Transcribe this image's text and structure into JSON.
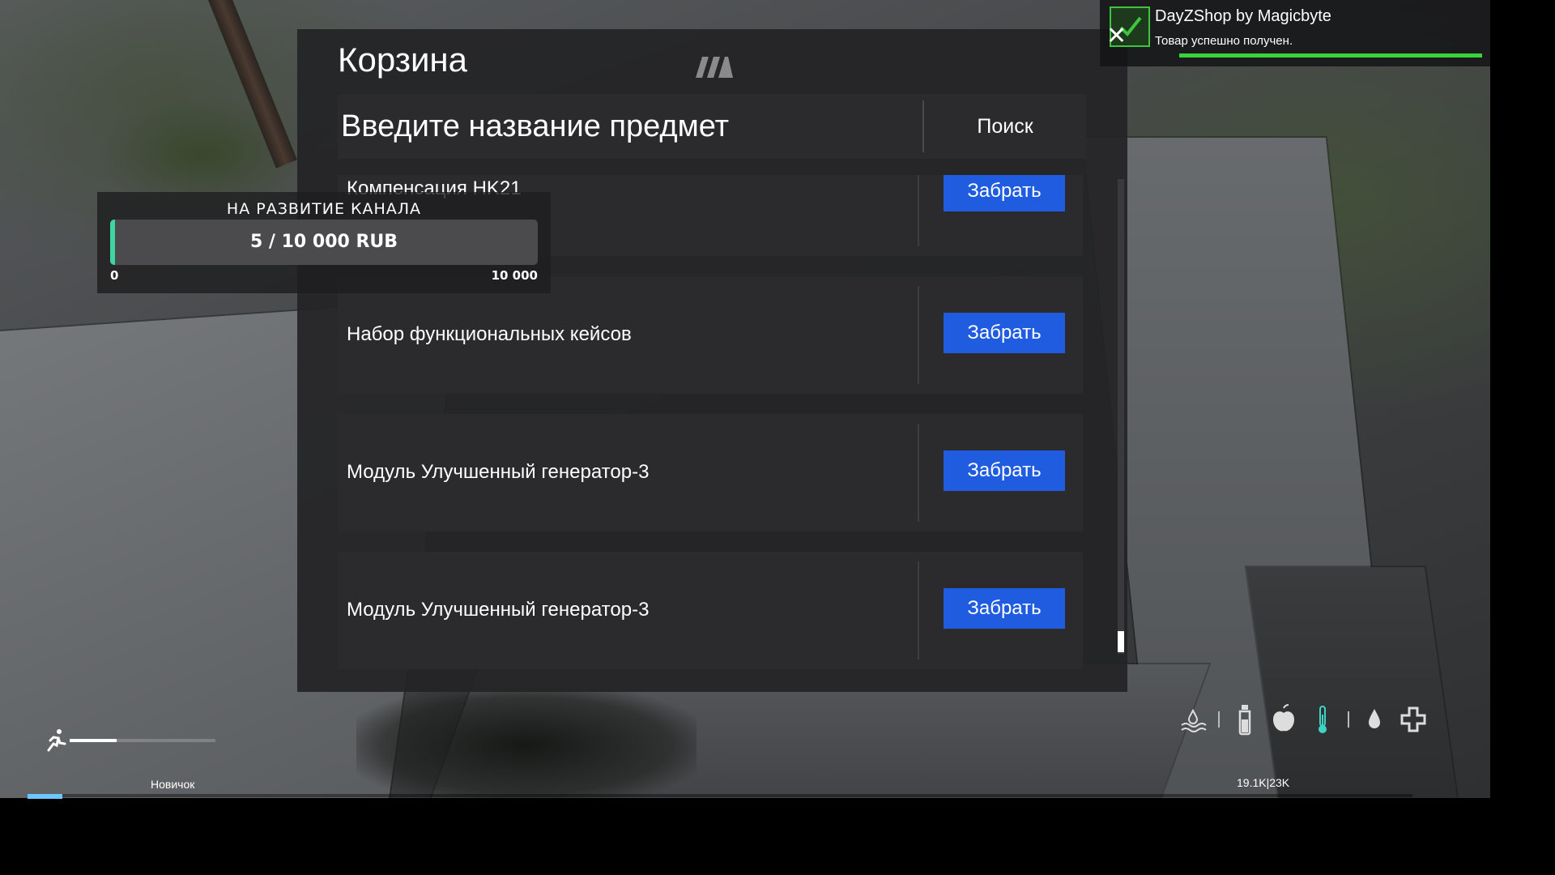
{
  "cart": {
    "title": "Корзина",
    "search": {
      "placeholder": "Введите название предмет",
      "button_label": "Поиск"
    },
    "items": [
      {
        "name": "Компенсация HK21",
        "action": "Забрать"
      },
      {
        "name": "Набор функциональных кейсов",
        "action": "Забрать"
      },
      {
        "name": "Модуль Улучшенный генератор-3",
        "action": "Забрать"
      },
      {
        "name": "Модуль Улучшенный генератор-3",
        "action": "Забрать"
      }
    ]
  },
  "donation": {
    "title": "НА РАЗВИТИЕ КАНАЛА",
    "amount_text": "5 / 10 000 RUB",
    "current": 5,
    "goal": 10000,
    "min_label": "0",
    "max_label": "10 000"
  },
  "notification": {
    "title": "DayZShop by Magicbyte",
    "message": "Товар успешно получен."
  },
  "hud": {
    "rank": "Новичок",
    "network": "19.1K|23K",
    "stamina_fraction": 0.32,
    "xp_fraction": 0.025,
    "icons": [
      "water-icon",
      "bottle-icon",
      "apple-icon",
      "thermometer-icon",
      "blood-drop-icon",
      "health-cross-icon"
    ]
  },
  "colors": {
    "accent_button": "#1f5ce0",
    "success_green": "#3ad43a",
    "donation_fill": "#3fd4a0"
  }
}
